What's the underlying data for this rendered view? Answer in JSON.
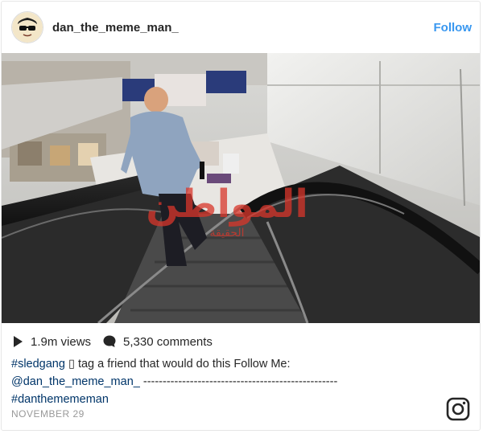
{
  "post": {
    "username": "dan_the_meme_man_",
    "follow_label": "Follow",
    "views": "1.9m views",
    "comments": "5,330 comments",
    "caption": {
      "hashtag1": "#sledgang",
      "emoji": "▯",
      "text1": "tag a friend that would do this Follow Me:",
      "mention": "@dan_the_meme_man_",
      "dashes": "--------------------------------------------------",
      "hashtag2": "#danthemememan"
    },
    "date": "NOVEMBER 29"
  },
  "media": {
    "description_icon": "escalator-video",
    "watermark_main": "المواطن",
    "watermark_sub": "الحقيقة"
  },
  "colors": {
    "link": "#3897f0",
    "hashtag": "#003569",
    "muted": "#999999"
  }
}
